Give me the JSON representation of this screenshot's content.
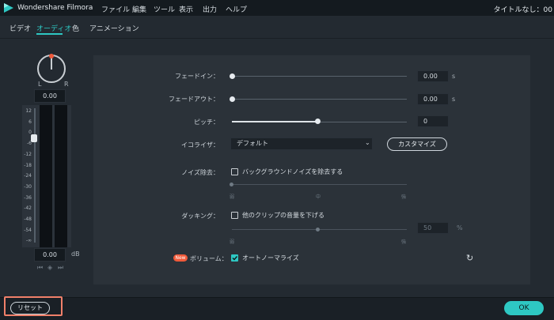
{
  "titlebar": {
    "app_title": "Wondershare Filmora",
    "menu": [
      "ファイル",
      "編集",
      "ツール",
      "表示",
      "出力",
      "ヘルプ"
    ],
    "document_title": "タイトルなし：00"
  },
  "tabs": [
    "ビデオ",
    "オーディオ",
    "色",
    "アニメーション"
  ],
  "active_tab": "オーディオ",
  "pan": {
    "left_label": "L",
    "right_label": "R",
    "value": "0.00"
  },
  "volume_meter": {
    "ticks": [
      "12",
      "6",
      "0",
      "-6",
      "-12",
      "-18",
      "-24",
      "-30",
      "-36",
      "-42",
      "-48",
      "-54",
      "-∞"
    ],
    "value": "0.00",
    "unit": "dB",
    "nav_icons": [
      "prev-keyframe-icon",
      "add-keyframe-icon",
      "next-keyframe-icon"
    ]
  },
  "settings": {
    "fade_in": {
      "label": "フェードイン：",
      "value": "0.00",
      "unit": "s",
      "fraction": 0
    },
    "fade_out": {
      "label": "フェードアウト：",
      "value": "0.00",
      "unit": "s",
      "fraction": 0
    },
    "pitch": {
      "label": "ピッチ：",
      "value": "0",
      "fraction": 0.5
    },
    "equalizer": {
      "label": "イコライザ：",
      "value": "デフォルト",
      "button": "カスタマイズ"
    },
    "denoise": {
      "label": "ノイズ除去：",
      "checkbox": "バックグラウンドノイズを除去する",
      "checked": false,
      "scale": [
        "弱",
        "中",
        "強"
      ]
    },
    "ducking": {
      "label": "ダッキング：",
      "checkbox": "他のクリップの音量を下げる",
      "checked": false,
      "value": "50",
      "unit": "%",
      "scale": [
        "弱",
        "強"
      ],
      "fraction": 0.5
    },
    "volume": {
      "badge": "New",
      "label": "ボリューム：",
      "checkbox": "オートノーマライズ",
      "checked": true
    }
  },
  "footer": {
    "reset": "リセット",
    "ok": "OK"
  },
  "colors": {
    "accent": "#2ec8c3",
    "highlight": "#f0806a",
    "badge": "#f05a3a"
  }
}
